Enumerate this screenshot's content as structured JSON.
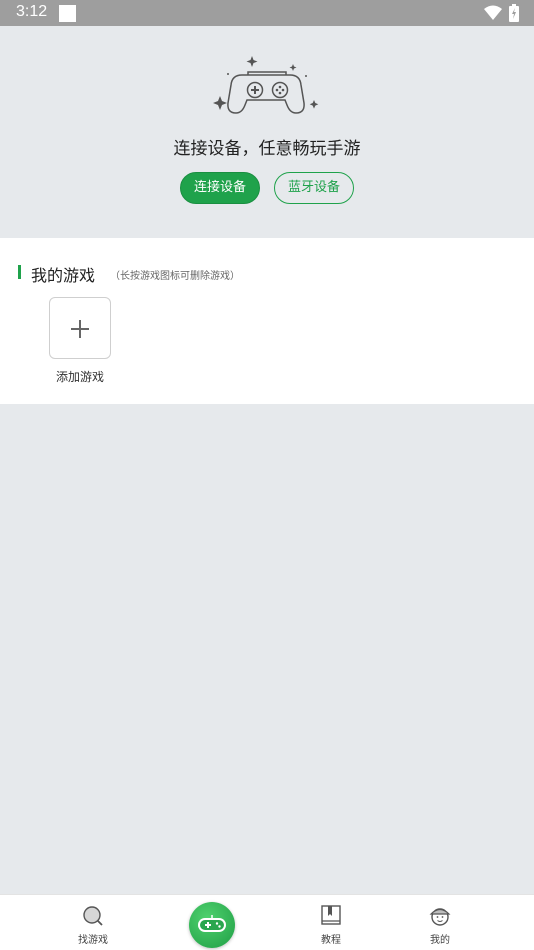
{
  "status_bar": {
    "time": "3:12"
  },
  "hero": {
    "tagline": "连接设备，任意畅玩手游",
    "connect_label": "连接设备",
    "bluetooth_label": "蓝牙设备"
  },
  "my_games": {
    "title": "我的游戏",
    "hint": "（长按游戏图标可删除游戏）",
    "add_label": "添加游戏"
  },
  "tabs": [
    {
      "label": "找游戏",
      "icon": "search-icon"
    },
    {
      "label": "",
      "icon": "gamepad-icon"
    },
    {
      "label": "教程",
      "icon": "book-icon"
    },
    {
      "label": "我的",
      "icon": "profile-icon"
    }
  ],
  "colors": {
    "accent": "#1fa24b",
    "background": "#e6e9ec",
    "status_bar": "#9e9e9e"
  }
}
